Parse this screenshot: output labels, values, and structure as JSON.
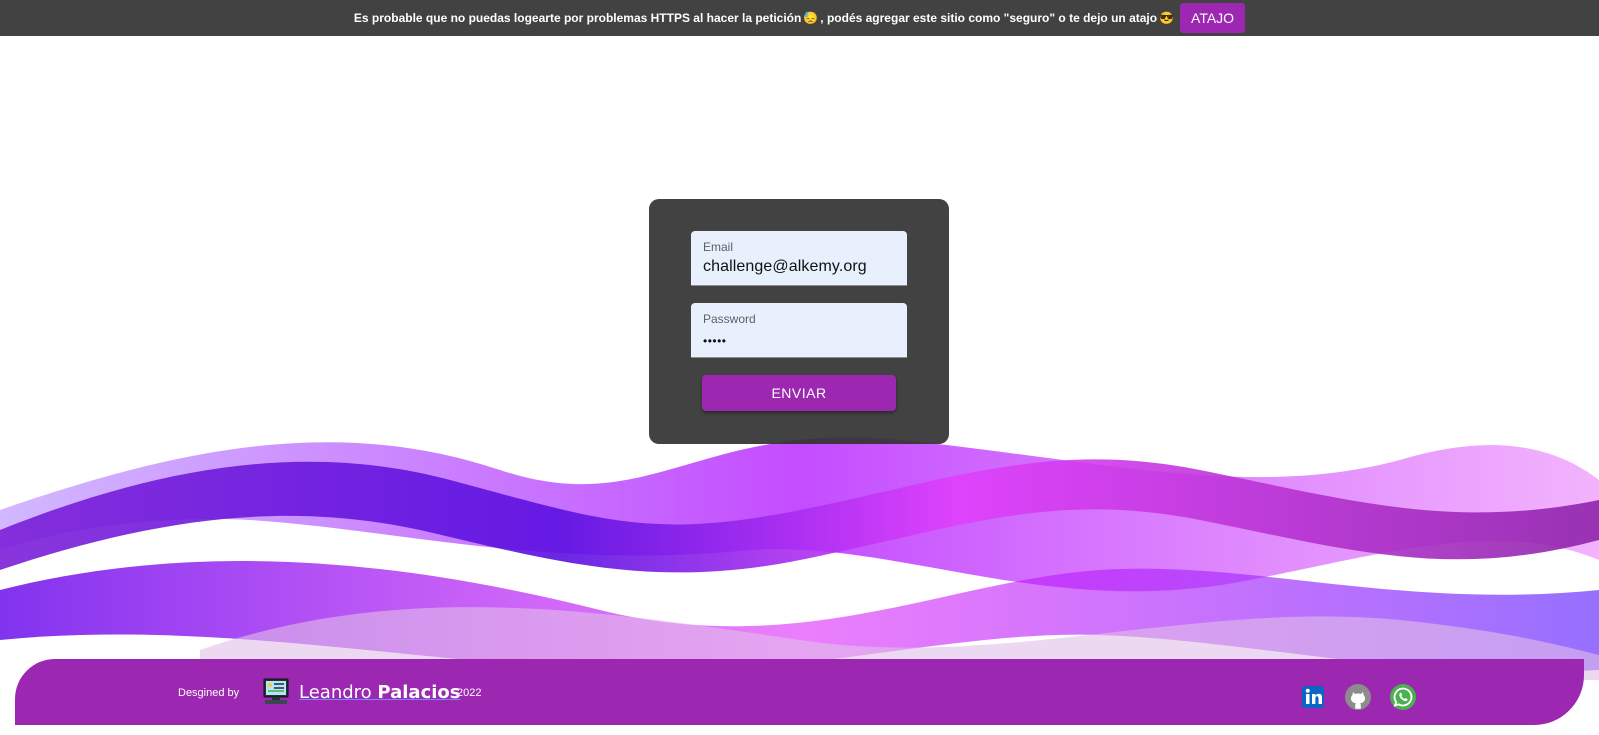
{
  "banner": {
    "text_part1": "Es probable que no puedas logearte por problemas HTTPS al hacer la petición",
    "emoji1": "😓",
    "text_part2": ", podés agregar este sitio como \"seguro\" o te dejo un atajo",
    "emoji2": "😎",
    "button_label": "ATAJO"
  },
  "login": {
    "email_label": "Email",
    "email_value": "challenge@alkemy.org",
    "password_label": "Password",
    "password_value": "•••••",
    "submit_label": "ENVIAR"
  },
  "footer": {
    "designed_by": "Desgined by",
    "name_light": "Leandro ",
    "name_bold": "Palacios",
    "year": "2022",
    "social": [
      {
        "name": "linkedin-icon"
      },
      {
        "name": "github-icon"
      },
      {
        "name": "whatsapp-icon"
      }
    ]
  },
  "colors": {
    "accent": "#9c27b0",
    "banner_bg": "#424242",
    "card_bg": "#343434",
    "input_bg": "#e8f0fe"
  }
}
